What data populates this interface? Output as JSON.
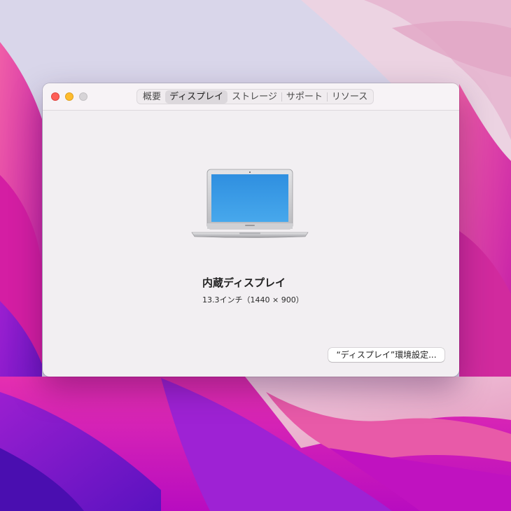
{
  "window": {
    "tabs": [
      {
        "label": "概要"
      },
      {
        "label": "ディスプレイ"
      },
      {
        "label": "ストレージ"
      },
      {
        "label": "サポート"
      },
      {
        "label": "リソース"
      }
    ],
    "selected_tab": "ディスプレイ"
  },
  "display": {
    "name": "内蔵ディスプレイ",
    "spec": "13.3インチ（1440 × 900）",
    "pref_button_label": "“ディスプレイ”環境設定..."
  },
  "colors": {
    "close": "#fe5f57",
    "minimize": "#febc2e",
    "zoom": "#d7d4d7",
    "screen_blue": "#3a9ee6"
  }
}
